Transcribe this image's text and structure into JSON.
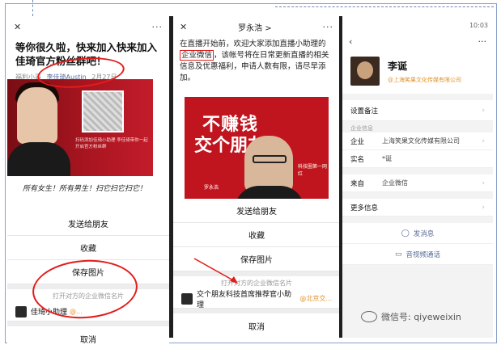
{
  "panel1": {
    "close": "✕",
    "more": "···",
    "title": "等你很久啦，快来加入快来加入佳琦官方粉丝群吧！",
    "meta_original": "福利小哥",
    "meta_account": "李佳琦Austin",
    "meta_date": "2月27日",
    "poster_text": "扫码添加佳琦小助理\n李佳琦带你一起开启官方粉丝群",
    "script_text": "所有女生！所有男生！扫它扫它扫它！",
    "sheet": {
      "send": "发送给朋友",
      "favorite": "收藏",
      "save": "保存图片",
      "hint": "打开对方的企业微信名片",
      "card_name": "佳琦小助理",
      "card_corp": "@...",
      "cancel": "取消"
    }
  },
  "panel2": {
    "close": "✕",
    "title": "罗永浩 >",
    "more": "···",
    "intro_a": "在直播开始前，欢迎大家添加直播小助理的",
    "intro_hl": "企业微信",
    "intro_b": "，该帐号将在日常更新直播的相关信息及优惠福利，申请人数有限，请尽早添加。",
    "poster_big1": "不赚钱",
    "poster_big2": "交个朋友",
    "poster_label": "罗永浩",
    "poster_side": "科技圈第一网红",
    "sheet": {
      "send": "发送给朋友",
      "favorite": "收藏",
      "save": "保存图片",
      "hint": "打开对方的企业微信名片",
      "card_name": "交个朋友科技首席推荐官小助理",
      "card_corp": "@北京交...",
      "cancel": "取消"
    }
  },
  "panel3": {
    "status_left": "",
    "status_right": "10:03",
    "back": "‹",
    "more": "···",
    "name": "李诞",
    "company": "@上海笑果文化传媒有限公司",
    "set_remark": "设置备注",
    "section": "企业信息",
    "rows": [
      {
        "label": "企业",
        "value": "上海笑果文化传媒有限公司"
      },
      {
        "label": "实名",
        "value": "*诞"
      },
      {
        "label": "来自",
        "value": "企业微信"
      },
      {
        "label": "更多信息",
        "value": ""
      }
    ],
    "send_msg": "发消息",
    "av_call": "音视频通话"
  },
  "watermark": "微信号: qiyeweixin",
  "colors": {
    "accent_red": "#e31c1c",
    "corp_orange": "#e0932a",
    "link_blue": "#576b95"
  }
}
